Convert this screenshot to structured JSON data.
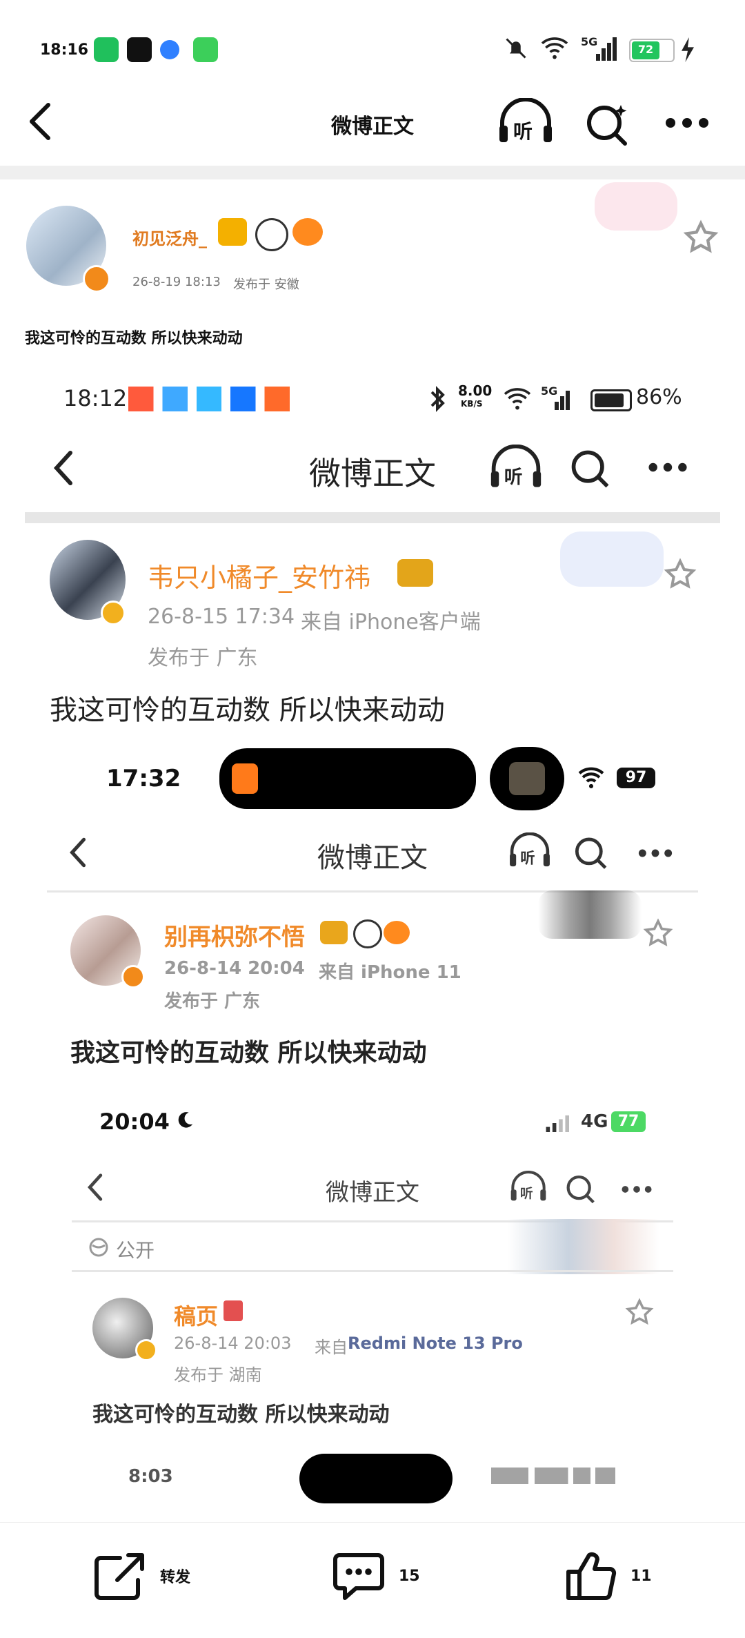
{
  "status": {
    "time": "18:16",
    "battery": "72"
  },
  "nav": {
    "title": "微博正文"
  },
  "post": {
    "username": "初见泛舟_",
    "time": "26-8-19 18:13",
    "location": "发布于 安徽",
    "content": "我这可怜的互动数 所以快来动动"
  },
  "shot1": {
    "status_time": "18:12",
    "speed_value": "8.00",
    "speed_unit": "KB/S",
    "battery": "86%",
    "title": "微博正文",
    "username": "韦只小橘子_安竹祎",
    "time": "26-8-15 17:34",
    "source": "来自 iPhone客户端",
    "location": "发布于 广东",
    "content": "我这可怜的互动数 所以快来动动"
  },
  "shot2": {
    "status_time": "17:32",
    "battery": "97",
    "title": "微博正文",
    "username": "别再枳弥不悟",
    "time": "26-8-14 20:04",
    "source": "来自 iPhone 11",
    "location": "发布于 广东",
    "content": "我这可怜的互动数 所以快来动动"
  },
  "shot3": {
    "status_time": "20:04",
    "network": "4G",
    "battery": "77",
    "title": "微博正文",
    "visibility": "公开",
    "username": "稿页",
    "time": "26-8-14 20:03",
    "source_prefix": "来自",
    "source_device": "Redmi Note 13 Pro",
    "location": "发布于 湖南",
    "content": "我这可怜的互动数 所以快来动动"
  },
  "shot4": {
    "status_time": "8:03"
  },
  "actions": {
    "repost_label": "转发",
    "comment_count": "15",
    "like_count": "11"
  },
  "colors": {
    "username": "#e07a1f",
    "accent": "#22c55e"
  }
}
